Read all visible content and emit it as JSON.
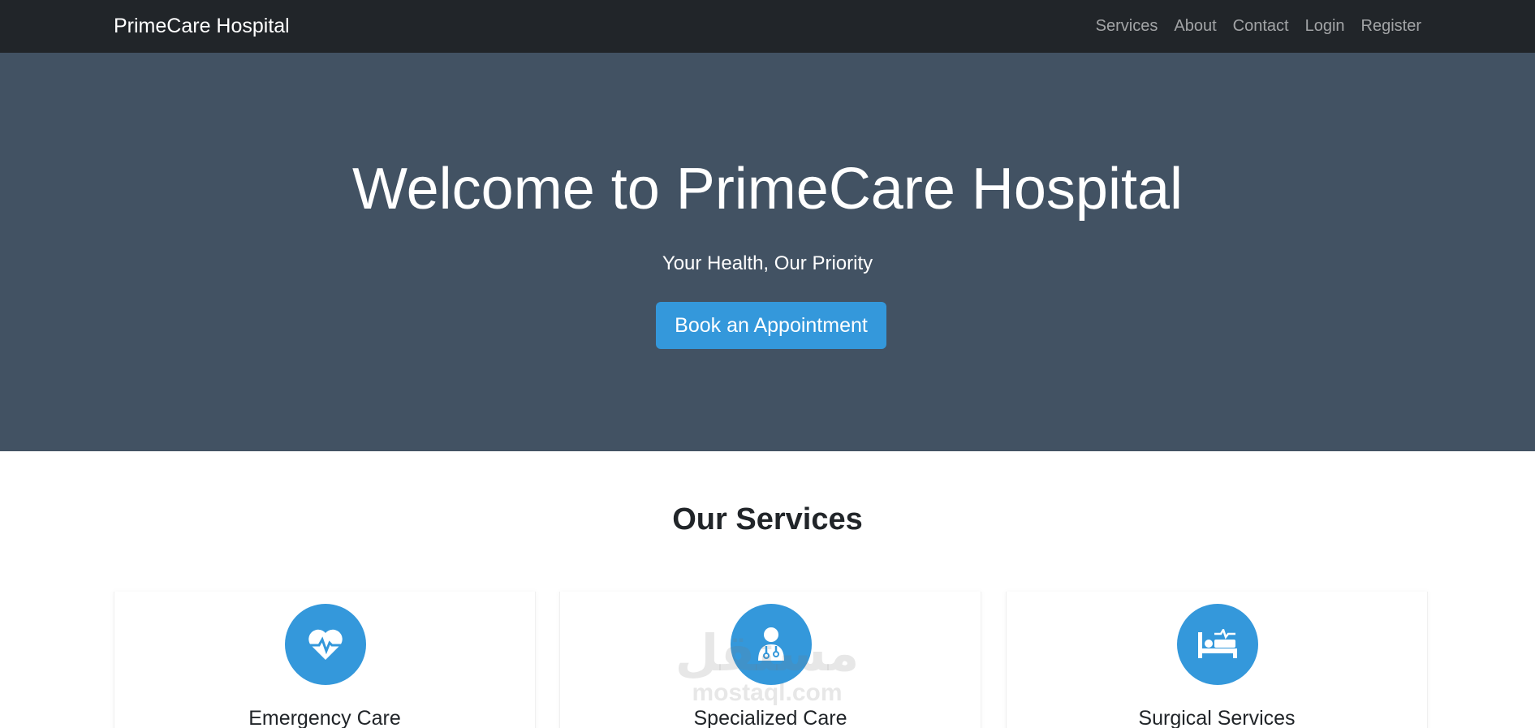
{
  "navbar": {
    "brand": "PrimeCare Hospital",
    "links": [
      "Services",
      "About",
      "Contact",
      "Login",
      "Register"
    ]
  },
  "hero": {
    "title": "Welcome to PrimeCare Hospital",
    "subtitle": "Your Health, Our Priority",
    "cta_label": "Book an Appointment"
  },
  "services": {
    "title": "Our Services",
    "cards": [
      {
        "title": "Emergency Care",
        "icon": "heart-pulse-icon"
      },
      {
        "title": "Specialized Care",
        "icon": "doctor-icon"
      },
      {
        "title": "Surgical Services",
        "icon": "hospital-bed-icon"
      }
    ]
  },
  "watermark": {
    "arabic": "مستقل",
    "latin": "mostaql.com"
  },
  "colors": {
    "navbar_bg": "#212529",
    "hero_bg": "#425263",
    "accent": "#3498db"
  }
}
